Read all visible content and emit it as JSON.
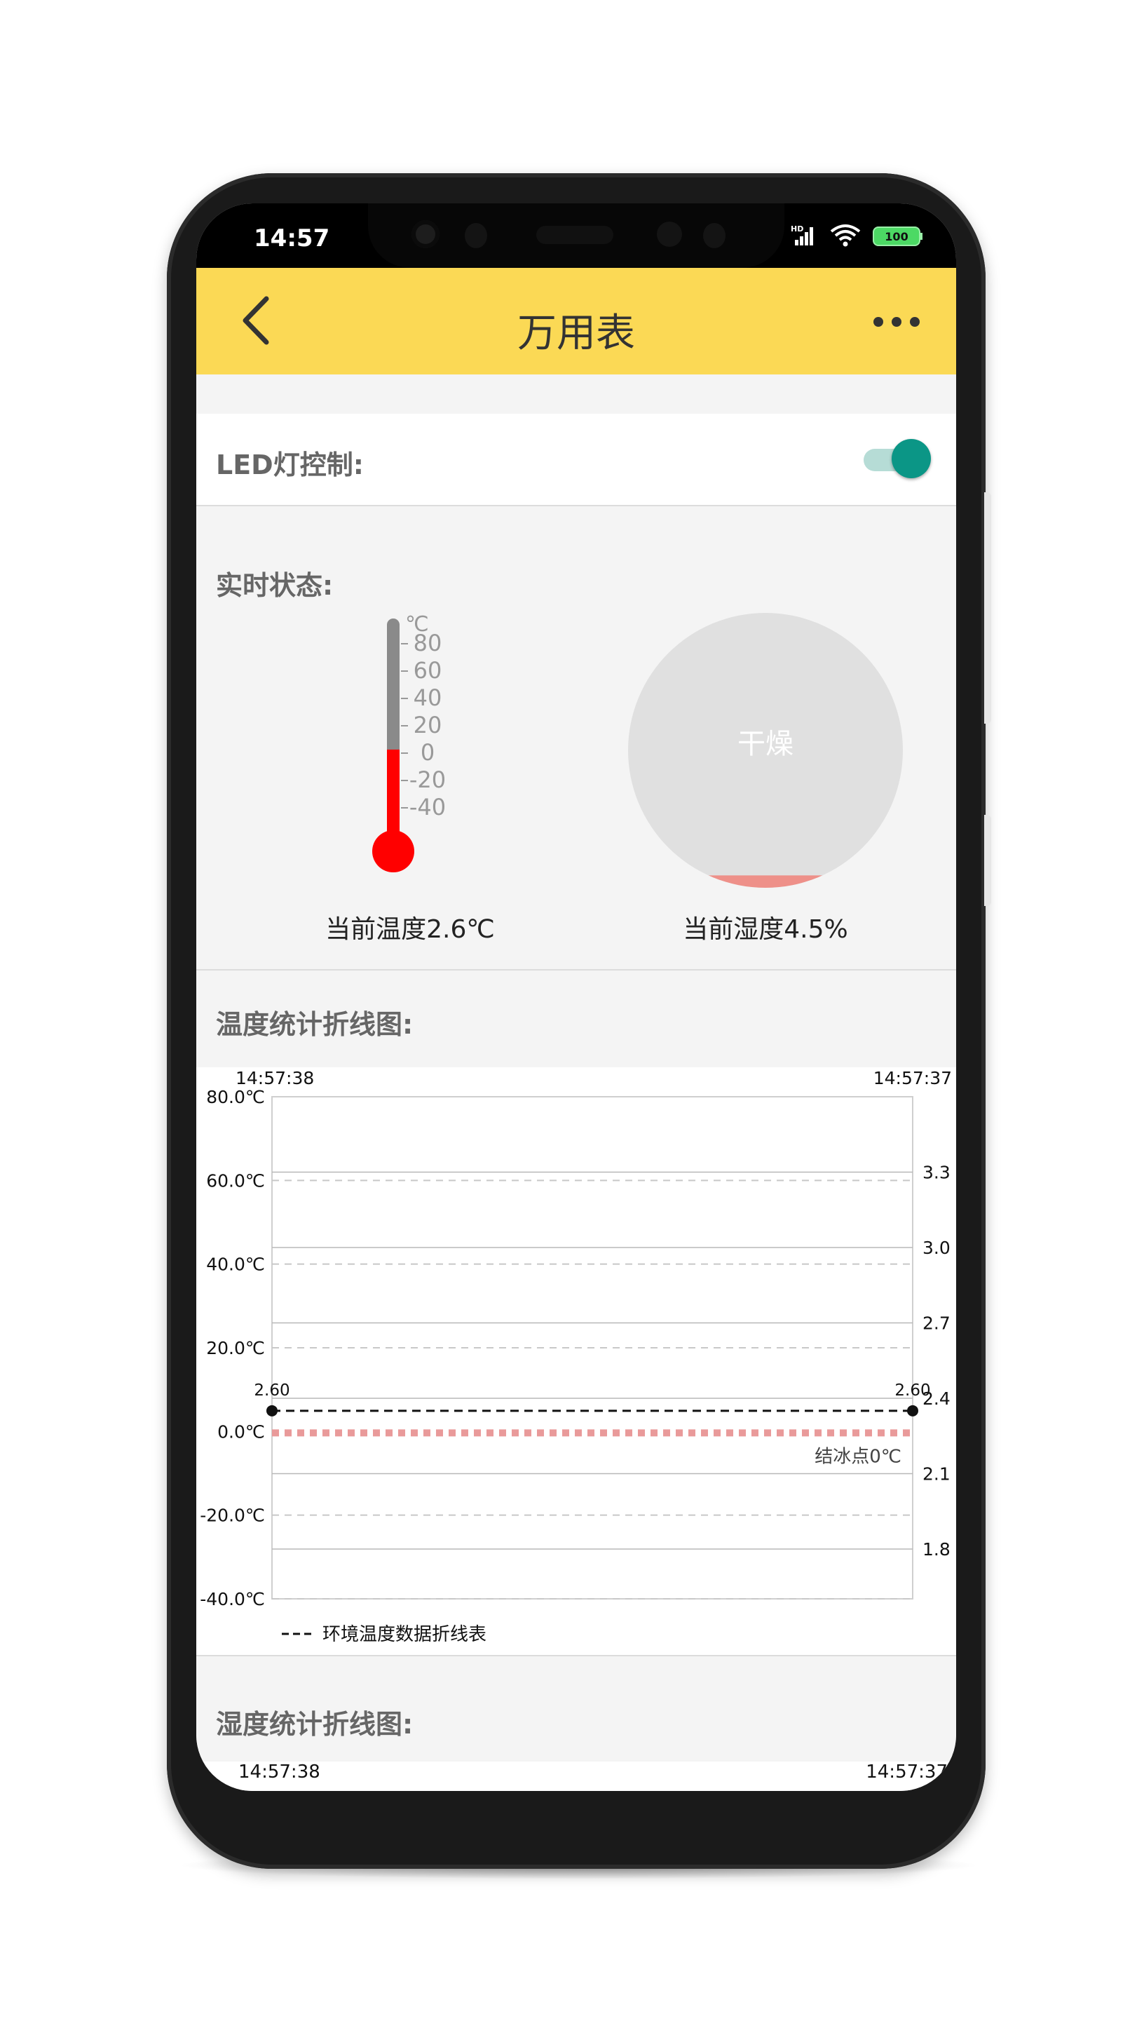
{
  "status_bar": {
    "time": "14:57",
    "battery": "100",
    "network": "HD"
  },
  "app_bar": {
    "title": "万用表"
  },
  "led": {
    "label": "LED灯控制:",
    "on": true
  },
  "realtime": {
    "label": "实时状态:",
    "thermometer": {
      "unit": "℃",
      "ticks": [
        "80",
        "60",
        "40",
        "20",
        "0",
        "-20",
        "-40"
      ],
      "value": 2.6,
      "caption": "当前温度2.6℃"
    },
    "humidity": {
      "state": "干燥",
      "value": 4.5,
      "caption": "当前湿度4.5%"
    }
  },
  "temp_chart_section": {
    "label": "温度统计折线图:"
  },
  "humidity_chart_section": {
    "label": "湿度统计折线图:"
  },
  "colors": {
    "appbar": "#fbd955",
    "toggle_accent": "#0b9686",
    "thermometer_red": "#ff0000",
    "freeze_line": "#e99a9a"
  },
  "chart_data": [
    {
      "type": "line",
      "title": "",
      "time_start": "14:57:38",
      "time_end": "14:57:37",
      "left_axis_labels": [
        "80.0℃",
        "60.0℃",
        "40.0℃",
        "20.0℃",
        "0.0℃",
        "-20.0℃",
        "-40.0℃"
      ],
      "right_axis_labels": [
        "3.3",
        "3.0",
        "2.7",
        "2.4",
        "2.1",
        "1.8"
      ],
      "ylim": [
        -40,
        80
      ],
      "series": [
        {
          "name": "环境温度数据折线表",
          "values": [
            2.6,
            2.6
          ]
        }
      ],
      "point_labels": [
        "2.60",
        "2.60"
      ],
      "limit_line": {
        "label": "结冰点0℃",
        "value": 0
      },
      "grid": true,
      "legend": "bottom-left"
    },
    {
      "type": "line",
      "time_start": "14:57:38",
      "time_end": "14:57:37"
    }
  ]
}
